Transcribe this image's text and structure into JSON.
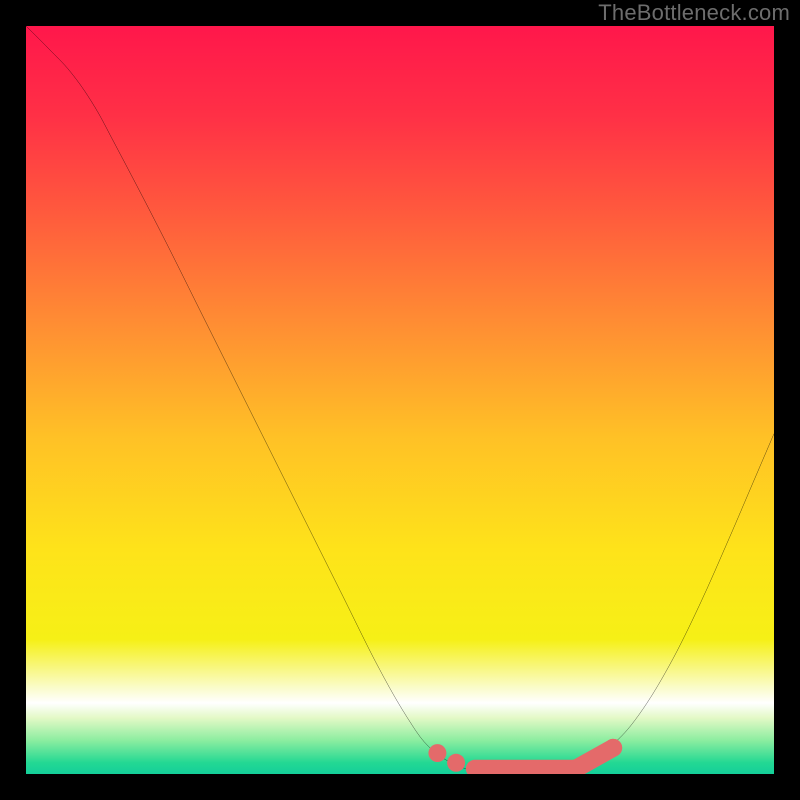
{
  "watermark": "TheBottleneck.com",
  "colors": {
    "page_bg": "#000000",
    "curve": "#000000",
    "marker": "#e46a6a",
    "gradient_stops": [
      {
        "offset": 0.0,
        "color": "#ff174b"
      },
      {
        "offset": 0.12,
        "color": "#ff3046"
      },
      {
        "offset": 0.25,
        "color": "#ff5a3d"
      },
      {
        "offset": 0.4,
        "color": "#ff8e33"
      },
      {
        "offset": 0.55,
        "color": "#ffc126"
      },
      {
        "offset": 0.7,
        "color": "#fee31a"
      },
      {
        "offset": 0.82,
        "color": "#f6f016"
      },
      {
        "offset": 0.885,
        "color": "#fafccb"
      },
      {
        "offset": 0.905,
        "color": "#ffffff"
      },
      {
        "offset": 0.925,
        "color": "#e3f9c6"
      },
      {
        "offset": 0.955,
        "color": "#8ceda0"
      },
      {
        "offset": 0.985,
        "color": "#23d893"
      },
      {
        "offset": 1.0,
        "color": "#14cf9a"
      }
    ]
  },
  "chart_data": {
    "type": "line",
    "title": "",
    "xlabel": "",
    "ylabel": "",
    "xlim": [
      0,
      100
    ],
    "ylim": [
      0,
      100
    ],
    "curve": [
      {
        "x": 0.0,
        "y": 100.0
      },
      {
        "x": 3.0,
        "y": 97.0
      },
      {
        "x": 6.0,
        "y": 93.8
      },
      {
        "x": 9.0,
        "y": 89.5
      },
      {
        "x": 12.0,
        "y": 84.0
      },
      {
        "x": 18.0,
        "y": 72.5
      },
      {
        "x": 24.0,
        "y": 60.5
      },
      {
        "x": 30.0,
        "y": 48.5
      },
      {
        "x": 36.0,
        "y": 36.5
      },
      {
        "x": 42.0,
        "y": 24.5
      },
      {
        "x": 47.0,
        "y": 14.5
      },
      {
        "x": 51.0,
        "y": 7.5
      },
      {
        "x": 54.0,
        "y": 3.5
      },
      {
        "x": 57.5,
        "y": 1.2
      },
      {
        "x": 61.0,
        "y": 0.3
      },
      {
        "x": 66.0,
        "y": 0.0
      },
      {
        "x": 71.0,
        "y": 0.3
      },
      {
        "x": 74.5,
        "y": 1.2
      },
      {
        "x": 78.5,
        "y": 4.0
      },
      {
        "x": 82.0,
        "y": 8.0
      },
      {
        "x": 86.0,
        "y": 14.5
      },
      {
        "x": 90.0,
        "y": 22.5
      },
      {
        "x": 94.0,
        "y": 31.5
      },
      {
        "x": 97.0,
        "y": 38.5
      },
      {
        "x": 100.0,
        "y": 45.5
      }
    ],
    "markers": [
      {
        "kind": "dot",
        "x": 55.0,
        "y": 2.8,
        "r": 1.2
      },
      {
        "kind": "dot",
        "x": 57.5,
        "y": 1.5,
        "r": 1.2
      },
      {
        "kind": "line",
        "x1": 60.0,
        "y1": 0.7,
        "x2": 73.5,
        "y2": 0.7,
        "w": 2.4
      },
      {
        "kind": "line",
        "x1": 73.5,
        "y1": 0.7,
        "x2": 78.5,
        "y2": 3.5,
        "w": 2.4
      },
      {
        "kind": "dot",
        "x": 78.5,
        "y": 3.5,
        "r": 1.2
      }
    ]
  }
}
